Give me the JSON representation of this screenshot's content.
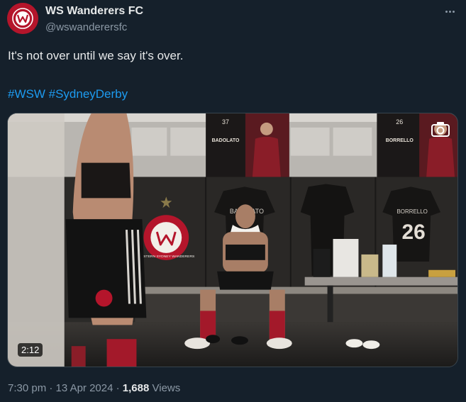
{
  "header": {
    "display_name": "WS Wanderers FC",
    "handle": "@wswanderersfc",
    "avatar_icon": "club-crest-icon",
    "more_icon": "more-options-icon"
  },
  "tweet": {
    "text": "It's not over until we say it's over.",
    "hashtags": [
      "#WSW",
      "#SydneyDerby"
    ]
  },
  "media": {
    "type": "video",
    "duration": "2:12",
    "overlay_icon": "camera-icon",
    "locker_banners": [
      {
        "number": "37",
        "name": "BADOLATO"
      },
      {
        "number": "26",
        "name": "BORRELLO"
      }
    ],
    "shirt_texts": {
      "left": "BADOLATO",
      "right_name": "BORRELLO",
      "right_number": "26"
    },
    "crest_text": "WESTERN SYDNEY WANDERERS"
  },
  "footer": {
    "time": "7:30 pm",
    "separator": "·",
    "date": "13 Apr 2024",
    "views_count": "1,688",
    "views_label": "Views"
  },
  "colors": {
    "background": "#15202b",
    "text": "#e7e9ea",
    "secondary_text": "#8b98a5",
    "link": "#1d9bf0",
    "club_red": "#b4152b"
  }
}
